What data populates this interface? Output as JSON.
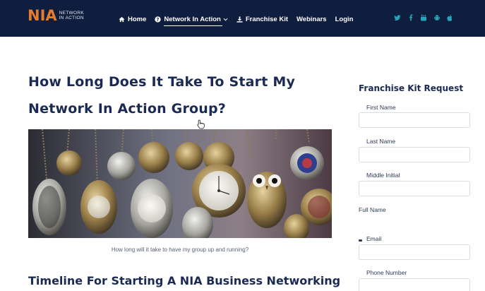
{
  "header": {
    "logo": {
      "mark": "NIA",
      "tag_line1": "Network",
      "tag_line2": "In Action"
    },
    "nav": [
      {
        "label": "Home",
        "icon": "home-icon"
      },
      {
        "label": "Network In Action",
        "icon": "question-circle-icon",
        "has_dropdown": true,
        "active": true
      },
      {
        "label": "Franchise Kit",
        "icon": "download-icon"
      },
      {
        "label": "Webinars"
      },
      {
        "label": "Login"
      }
    ],
    "social": [
      "twitter-icon",
      "facebook-icon",
      "youtube-icon",
      "android-icon",
      "apple-icon"
    ],
    "colors": {
      "bar": "#0f1d3f",
      "accent": "#e77c2a",
      "social": "#2aa3b8"
    }
  },
  "article": {
    "title": "How Long Does It Take To Start My Network In Action Group?",
    "image_caption": "How long will it take to have my group up and running?",
    "subtitle": "Timeline For Starting A NIA Business Networking"
  },
  "sidebar": {
    "form_title": "Franchise Kit Request",
    "fields": {
      "first_name": "First Name",
      "last_name": "Last Name",
      "middle_initial": "Middle Initial",
      "full_name": "Full Name",
      "email": "Email",
      "phone": "Phone Number"
    }
  }
}
